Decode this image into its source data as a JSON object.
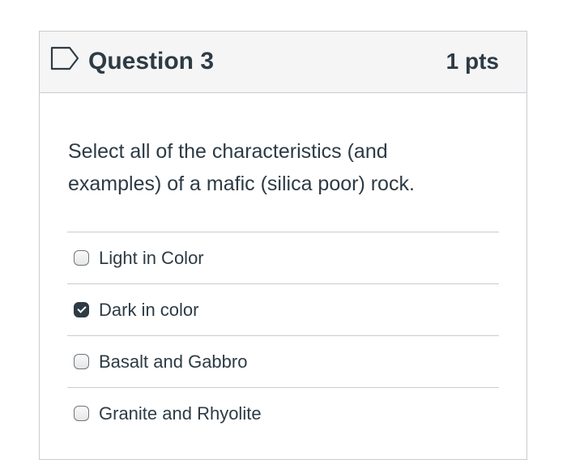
{
  "question": {
    "title": "Question 3",
    "points": "1 pts",
    "text": "Select all of the characteristics (and examples) of a mafic (silica poor) rock.",
    "flag_icon": "bookmark-flag-outline-icon"
  },
  "answers": [
    {
      "label": "Light in Color",
      "checked": false
    },
    {
      "label": "Dark in color",
      "checked": true
    },
    {
      "label": "Basalt and Gabbro",
      "checked": false
    },
    {
      "label": "Granite and Rhyolite",
      "checked": false
    }
  ],
  "colors": {
    "text": "#2d3b45",
    "header_bg": "#f5f5f5",
    "border": "#c7cdd1"
  }
}
